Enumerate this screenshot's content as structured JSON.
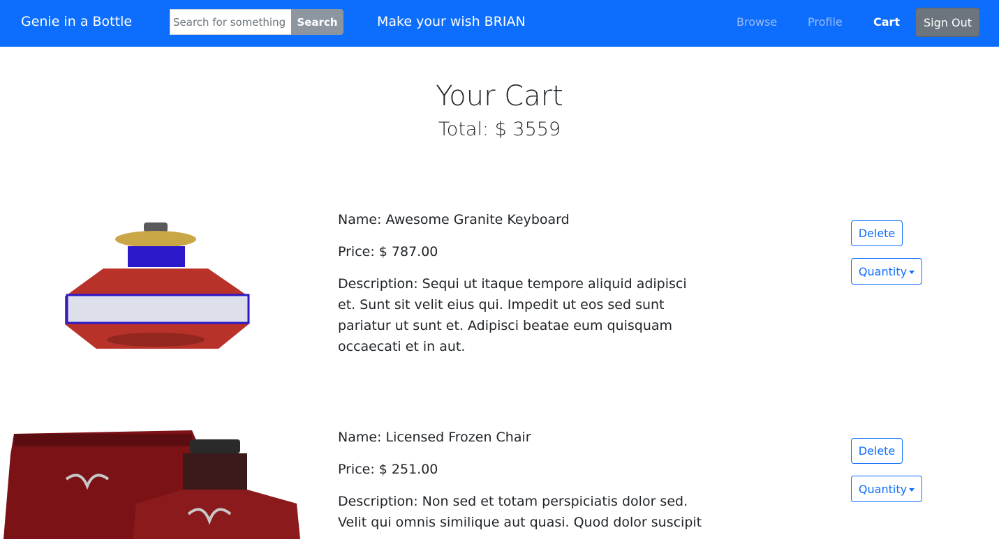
{
  "navbar": {
    "brand": "Genie in a Bottle",
    "search_placeholder": "Search for something",
    "search_button": "Search",
    "greeting": "Make your wish BRIAN",
    "links": {
      "browse": "Browse",
      "profile": "Profile",
      "cart": "Cart"
    },
    "sign_out": "Sign Out",
    "colors": {
      "navbar_bg": "#0d6efd",
      "inactive_link": "#9bbcf5",
      "sign_out_bg": "#6c757d"
    }
  },
  "cart": {
    "title": "Your Cart",
    "total": "Total: $ 3559"
  },
  "items": [
    {
      "name": "Name: Awesome Granite Keyboard",
      "price": "Price: $ 787.00",
      "description": "Description: Sequi ut itaque tempore aliquid adipisci et. Sunt sit velit eius qui. Impedit ut eos sed sunt pariatur ut sunt et. Adipisci beatae eum quisquam occaecati et in aut.",
      "delete_label": "Delete",
      "quantity_label": "Quantity"
    },
    {
      "name": "Name: Licensed Frozen Chair",
      "price": "Price: $ 251.00",
      "description": "Description: Non sed et totam perspiciatis dolor sed. Velit qui omnis similique aut quasi. Quod dolor suscipit",
      "delete_label": "Delete",
      "quantity_label": "Quantity"
    }
  ]
}
